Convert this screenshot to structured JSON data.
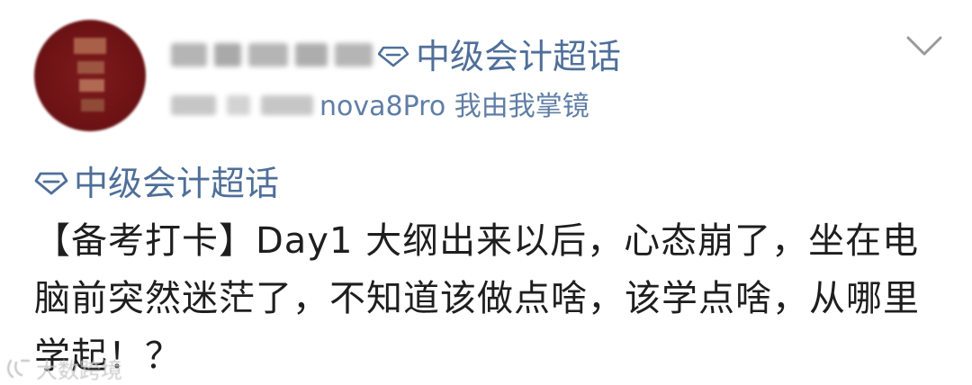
{
  "header": {
    "supertopic_name": "中级会计超话",
    "device_text": "nova8Pro 我由我掌镜"
  },
  "post": {
    "topic_tag": "中级会计超话",
    "body": "【备考打卡】Day1 大纲出来以后，心态崩了，坐在电脑前突然迷茫了，不知道该做点啥，该学点啥，从哪里学起！？"
  },
  "watermark": {
    "text": "大数跨境"
  },
  "icons": {
    "supertopic": "diamond-icon",
    "menu": "chevron-down-icon",
    "watermark": "watermark-logo-icon"
  },
  "colors": {
    "link_blue": "#4f6f99",
    "avatar_red": "#6e1315",
    "text": "#1e1e1e"
  }
}
